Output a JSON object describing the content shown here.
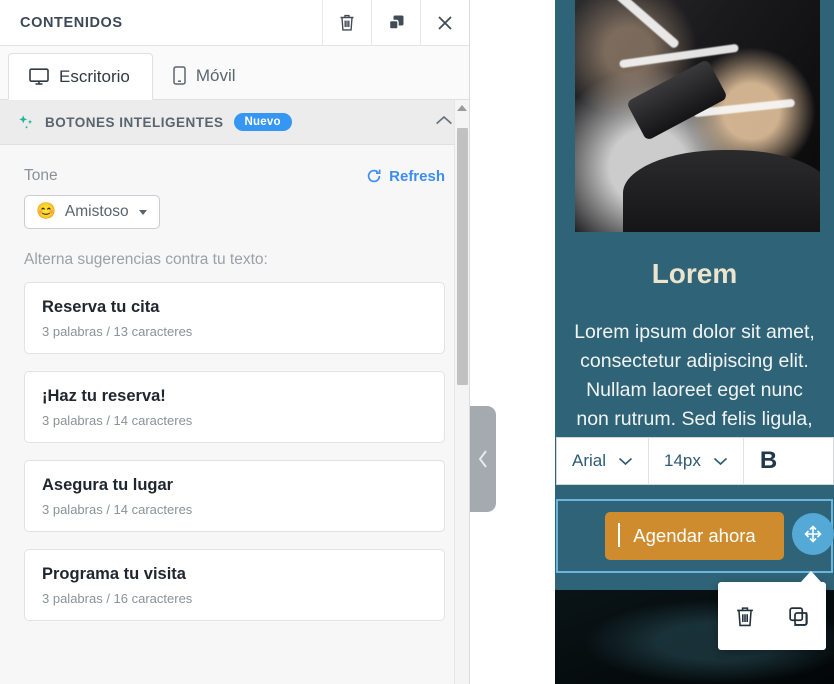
{
  "panel": {
    "title": "CONTENIDOS",
    "header_actions": [
      {
        "name": "delete-icon",
        "label": "Eliminar"
      },
      {
        "name": "duplicate-icon",
        "label": "Duplicar"
      },
      {
        "name": "close-icon",
        "label": "Cerrar"
      }
    ],
    "tabs": [
      {
        "label": "Escritorio",
        "icon": "desktop-icon",
        "active": true
      },
      {
        "label": "Móvil",
        "icon": "mobile-icon",
        "active": false
      }
    ]
  },
  "smart_buttons": {
    "section_title": "BOTONES INTELIGENTES",
    "badge": "Nuevo",
    "sparkle_icon": "sparkle-icon",
    "collapse_icon": "chevron-up-icon",
    "tone_label": "Tone",
    "tone_value": "Amistoso",
    "tone_emoji": "😊",
    "refresh_label": "Refresh",
    "refresh_icon": "refresh-icon",
    "alternatives_label": "Alterna sugerencias contra tu texto:",
    "suggestions": [
      {
        "text": "Reserva tu cita",
        "meta": "3 palabras / 13 caracteres"
      },
      {
        "text": "¡Haz tu reserva!",
        "meta": "3 palabras / 14 caracteres"
      },
      {
        "text": "Asegura tu lugar",
        "meta": "3 palabras / 14 caracteres"
      },
      {
        "text": "Programa tu visita",
        "meta": "3 palabras / 16 caracteres"
      }
    ]
  },
  "preview": {
    "heading": "Lorem",
    "body": "Lorem ipsum dolor sit amet, consectetur adipiscing elit. Nullam laoreet eget nunc non rutrum. Sed felis ligula,",
    "cta_label": "Agendar ahora",
    "background_color": "#2e6378",
    "cta_color": "#cf8c2e",
    "heading_color": "#ece4cc",
    "selection_color": "#6cb6dd"
  },
  "font_toolbar": {
    "font_family": "Arial",
    "font_size": "14px",
    "bold_label": "B"
  },
  "floating_toolbar": {
    "actions": [
      {
        "name": "delete-icon",
        "label": "Eliminar"
      },
      {
        "name": "duplicate-icon",
        "label": "Duplicar"
      }
    ]
  },
  "collapse_handle": {
    "icon": "chevron-left-icon"
  },
  "move_handle": {
    "icon": "move-arrows-icon"
  }
}
